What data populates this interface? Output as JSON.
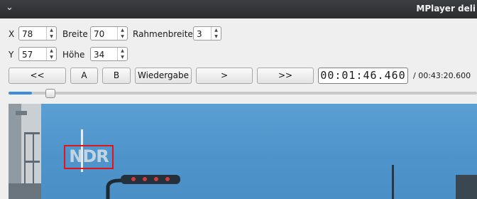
{
  "window": {
    "title": "MPlayer deli",
    "menu_icon": "chevron-down-icon"
  },
  "fields": {
    "x": {
      "label": "X",
      "value": "78"
    },
    "breite": {
      "label": "Breite",
      "value": "70"
    },
    "rahmenbreite": {
      "label": "Rahmenbreite",
      "value": "3"
    },
    "y": {
      "label": "Y",
      "value": "57"
    },
    "hoehe": {
      "label": "Höhe",
      "value": "34"
    }
  },
  "controls": {
    "prev": "<<",
    "a": "A",
    "b": "B",
    "play": "Wiedergabe",
    "next": ">",
    "fast_forward": ">>",
    "current_time": "00:01:46.460",
    "total_time": "/ 00:43:20.600"
  },
  "seek": {
    "position_fraction": 0.041,
    "accent_color": "#3d8ee0"
  },
  "video": {
    "logo_text": "NDR",
    "selection_color": "#e0141b"
  }
}
